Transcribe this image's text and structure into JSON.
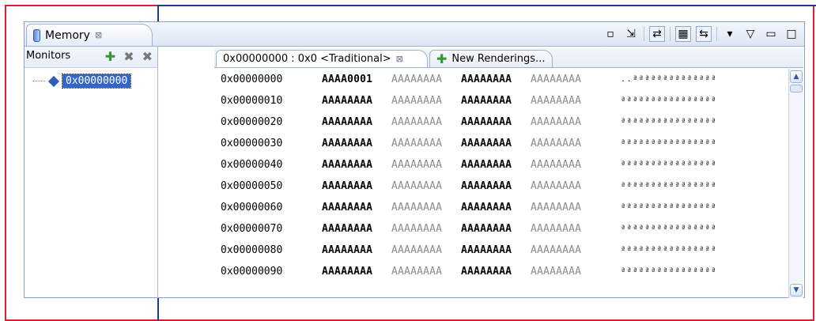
{
  "view": {
    "tab_label": "Memory",
    "close_glyph": "⊠",
    "toolbar": [
      {
        "name": "new-monitor-icon",
        "glyph": "▫"
      },
      {
        "name": "export-icon",
        "glyph": "⇲"
      },
      {
        "name": "toggle-memory-monitors-icon",
        "glyph": "⇄",
        "pressed": true
      },
      {
        "name": "toggle-split-pane-icon",
        "glyph": "▦",
        "pressed": true
      },
      {
        "name": "link-memory-panes-icon",
        "glyph": "⇆",
        "pressed": true
      },
      {
        "name": "view-menu-icon",
        "glyph": "▾"
      }
    ],
    "window_controls": {
      "menu": "▽",
      "minimize": "▭",
      "maximize": "□"
    }
  },
  "monitors": {
    "title": "Monitors",
    "add_glyph": "✚",
    "remove_glyph": "✖",
    "remove_all_glyph": "✖",
    "items": [
      {
        "label": "0x00000000",
        "selected": true
      }
    ]
  },
  "renderings": {
    "tabs": [
      {
        "label": "0x00000000 : 0x0 <Traditional>",
        "close": "⊠"
      },
      {
        "label": "New Renderings...",
        "icon": "✚"
      }
    ],
    "rows": [
      {
        "address": "0x00000000",
        "cells": [
          "AAAA0001",
          "AAAAAAAA",
          "AAAAAAAA",
          "AAAAAAAA"
        ],
        "ascii": "..ªªªªªªªªªªªªªª"
      },
      {
        "address": "0x00000010",
        "cells": [
          "AAAAAAAA",
          "AAAAAAAA",
          "AAAAAAAA",
          "AAAAAAAA"
        ],
        "ascii": "ªªªªªªªªªªªªªªªª"
      },
      {
        "address": "0x00000020",
        "cells": [
          "AAAAAAAA",
          "AAAAAAAA",
          "AAAAAAAA",
          "AAAAAAAA"
        ],
        "ascii": "ªªªªªªªªªªªªªªªª"
      },
      {
        "address": "0x00000030",
        "cells": [
          "AAAAAAAA",
          "AAAAAAAA",
          "AAAAAAAA",
          "AAAAAAAA"
        ],
        "ascii": "ªªªªªªªªªªªªªªªª"
      },
      {
        "address": "0x00000040",
        "cells": [
          "AAAAAAAA",
          "AAAAAAAA",
          "AAAAAAAA",
          "AAAAAAAA"
        ],
        "ascii": "ªªªªªªªªªªªªªªªª"
      },
      {
        "address": "0x00000050",
        "cells": [
          "AAAAAAAA",
          "AAAAAAAA",
          "AAAAAAAA",
          "AAAAAAAA"
        ],
        "ascii": "ªªªªªªªªªªªªªªªª"
      },
      {
        "address": "0x00000060",
        "cells": [
          "AAAAAAAA",
          "AAAAAAAA",
          "AAAAAAAA",
          "AAAAAAAA"
        ],
        "ascii": "ªªªªªªªªªªªªªªªª"
      },
      {
        "address": "0x00000070",
        "cells": [
          "AAAAAAAA",
          "AAAAAAAA",
          "AAAAAAAA",
          "AAAAAAAA"
        ],
        "ascii": "ªªªªªªªªªªªªªªªª"
      },
      {
        "address": "0x00000080",
        "cells": [
          "AAAAAAAA",
          "AAAAAAAA",
          "AAAAAAAA",
          "AAAAAAAA"
        ],
        "ascii": "ªªªªªªªªªªªªªªªª"
      },
      {
        "address": "0x00000090",
        "cells": [
          "AAAAAAAA",
          "AAAAAAAA",
          "AAAAAAAA",
          "AAAAAAAA"
        ],
        "ascii": "ªªªªªªªªªªªªªªªª"
      }
    ],
    "scrollbar": {
      "up": "▲",
      "down": "▼"
    }
  },
  "colors": {
    "annotation_red": "#d9232d",
    "annotation_blue": "#1d3a8f",
    "selection": "#3366cc",
    "add_green": "#2f9b2f"
  }
}
